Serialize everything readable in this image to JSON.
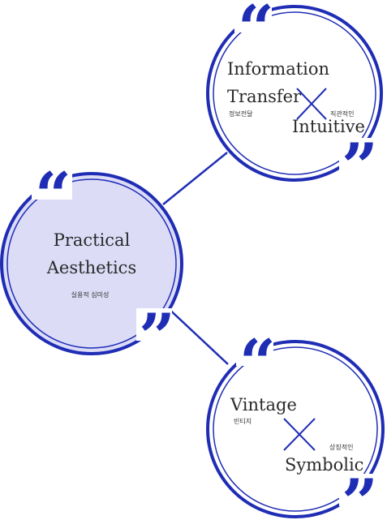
{
  "colors": {
    "accent": "#1f2db5",
    "fill_center": "#dcdcf7",
    "text": "#2a2a2a"
  },
  "quote_open": "“",
  "quote_close": "”",
  "nodes": {
    "practical": {
      "line1": "Practical",
      "line2": "Aesthetics",
      "korean": "실용적 심미성"
    },
    "information": {
      "line1": "Information",
      "line2": "Transfer",
      "korean_left": "정보전달",
      "line3": "Intuitive",
      "korean_right": "직관적인"
    },
    "vintage": {
      "line1": "Vintage",
      "korean_left": "빈티지",
      "line2": "Symbolic",
      "korean_right": "상징적인"
    }
  }
}
